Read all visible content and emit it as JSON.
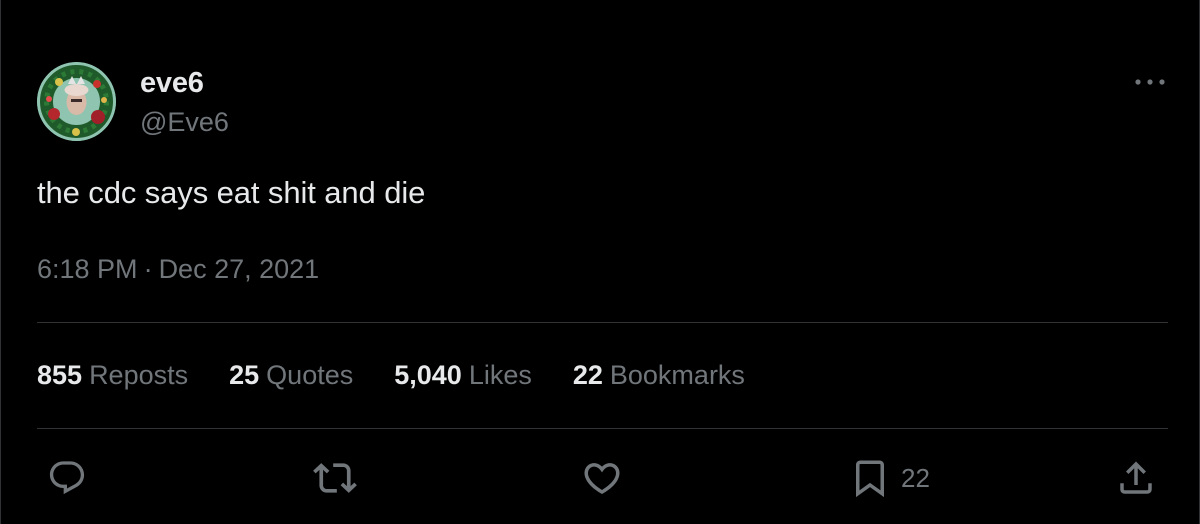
{
  "author": {
    "display_name": "eve6",
    "handle": "@Eve6"
  },
  "tweet": {
    "text": "the cdc says eat shit and die",
    "time": "6:18 PM",
    "separator": "·",
    "date": "Dec 27, 2021"
  },
  "stats": {
    "reposts": {
      "count": "855",
      "label": "Reposts"
    },
    "quotes": {
      "count": "25",
      "label": "Quotes"
    },
    "likes": {
      "count": "5,040",
      "label": "Likes"
    },
    "bookmarks": {
      "count": "22",
      "label": "Bookmarks"
    }
  },
  "actions": {
    "reply_icon": "speech-bubble-icon",
    "repost_icon": "repost-arrows-icon",
    "like_icon": "heart-icon",
    "bookmark_icon": "bookmark-icon",
    "bookmark_count": "22",
    "share_icon": "share-upload-icon"
  },
  "colors": {
    "background": "#000000",
    "primary_text": "#e7e9ea",
    "secondary_text": "#71767b",
    "divider": "#2f3336"
  }
}
